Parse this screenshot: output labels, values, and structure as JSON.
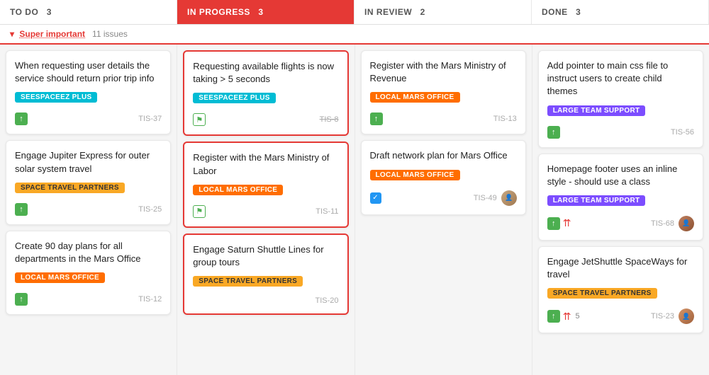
{
  "board": {
    "columns": [
      {
        "id": "todo",
        "label": "TO DO",
        "count": 3,
        "highlighted": false
      },
      {
        "id": "in-progress",
        "label": "IN PROGRESS",
        "count": 3,
        "highlighted": true
      },
      {
        "id": "in-review",
        "label": "IN REVIEW",
        "count": 2,
        "highlighted": false
      },
      {
        "id": "done",
        "label": "DONE",
        "count": 3,
        "highlighted": false
      }
    ],
    "group_label": "Super important",
    "group_issue_count": "11 issues",
    "cards": {
      "todo": [
        {
          "title": "When requesting user details the service should return prior trip info",
          "badge": "SEESPACEEZ PLUS",
          "badge_class": "badge-cyan",
          "ticket": "TIS-37",
          "ticket_strikethrough": false,
          "icon": "up",
          "has_avatar": false,
          "has_checkbox": false,
          "priority": false,
          "vote_count": null
        },
        {
          "title": "Engage Jupiter Express for outer solar system travel",
          "badge": "SPACE TRAVEL PARTNERS",
          "badge_class": "badge-yellow",
          "ticket": "TIS-25",
          "ticket_strikethrough": false,
          "icon": "up",
          "has_avatar": false,
          "has_checkbox": false,
          "priority": false,
          "vote_count": null
        },
        {
          "title": "Create 90 day plans for all departments in the Mars Office",
          "badge": "LOCAL MARS OFFICE",
          "badge_class": "badge-orange",
          "ticket": "TIS-12",
          "ticket_strikethrough": false,
          "icon": "up",
          "has_avatar": false,
          "has_checkbox": false,
          "priority": false,
          "vote_count": null
        }
      ],
      "in-progress": [
        {
          "title": "Requesting available flights is now taking > 5 seconds",
          "badge": "SEESPACEEZ PLUS",
          "badge_class": "badge-cyan",
          "ticket": "TIS-8",
          "ticket_strikethrough": true,
          "icon": "flag",
          "has_avatar": false,
          "has_checkbox": false,
          "priority": false,
          "vote_count": null,
          "highlighted": true
        },
        {
          "title": "Register with the Mars Ministry of Labor",
          "badge": "LOCAL MARS OFFICE",
          "badge_class": "badge-orange",
          "ticket": "TIS-11",
          "ticket_strikethrough": false,
          "icon": "flag",
          "has_avatar": false,
          "has_checkbox": false,
          "priority": false,
          "vote_count": null,
          "highlighted": true
        },
        {
          "title": "Engage Saturn Shuttle Lines for group tours",
          "badge": "SPACE TRAVEL PARTNERS",
          "badge_class": "badge-yellow",
          "ticket": "TIS-20",
          "ticket_strikethrough": false,
          "icon": null,
          "has_avatar": false,
          "has_checkbox": false,
          "priority": false,
          "vote_count": null,
          "highlighted": true
        }
      ],
      "in-review": [
        {
          "title": "Register with the Mars Ministry of Revenue",
          "badge": "LOCAL MARS OFFICE",
          "badge_class": "badge-orange",
          "ticket": "TIS-13",
          "ticket_strikethrough": false,
          "icon": "up",
          "has_avatar": false,
          "has_checkbox": false,
          "priority": false,
          "vote_count": null
        },
        {
          "title": "Draft network plan for Mars Office",
          "badge": "LOCAL MARS OFFICE",
          "badge_class": "badge-orange",
          "ticket": "TIS-49",
          "ticket_strikethrough": false,
          "icon": "checkbox",
          "has_avatar": true,
          "has_checkbox": false,
          "priority": false,
          "vote_count": null
        }
      ],
      "done": [
        {
          "title": "Add pointer to main css file to instruct users to create child themes",
          "badge": "LARGE TEAM SUPPORT",
          "badge_class": "badge-purple",
          "ticket": "TIS-56",
          "ticket_strikethrough": false,
          "icon": "up",
          "has_avatar": false,
          "has_checkbox": false,
          "priority": false,
          "vote_count": null
        },
        {
          "title": "Homepage footer uses an inline style - should use a class",
          "badge": "LARGE TEAM SUPPORT",
          "badge_class": "badge-purple",
          "ticket": "TIS-68",
          "ticket_strikethrough": false,
          "icon": "up",
          "has_avatar": true,
          "has_checkbox": false,
          "priority": true,
          "vote_count": null
        },
        {
          "title": "Engage JetShuttle SpaceWays for travel",
          "badge": "SPACE TRAVEL PARTNERS",
          "badge_class": "badge-yellow",
          "ticket": "TIS-23",
          "ticket_strikethrough": false,
          "icon": "up",
          "has_avatar": true,
          "has_checkbox": false,
          "priority": true,
          "vote_count": "5"
        }
      ]
    }
  }
}
